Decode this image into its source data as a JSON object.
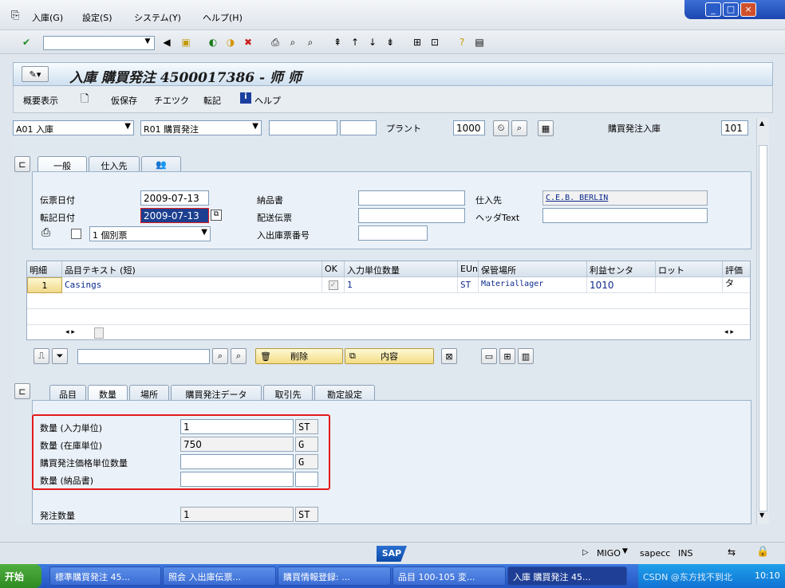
{
  "menu": {
    "items": [
      "入庫(G)",
      "設定(S)",
      "システム(Y)",
      "ヘルプ(H)"
    ]
  },
  "window_controls": {
    "minimize": "_",
    "maximize": "□",
    "close": "×"
  },
  "title": "入庫 購買発注 4500017386 - 师 师",
  "app_toolbar": {
    "overview": "概要表示",
    "hold": "仮保存",
    "check": "チエツク",
    "post": "転記",
    "help": "ヘルプ"
  },
  "header_row": {
    "transaction_select": "A01 入庫",
    "reference_select": "R01 購買発注",
    "field1": "",
    "field2": "",
    "plant_label": "プラント",
    "plant_value": "1000",
    "movement_label": "購買発注入庫",
    "movement_value": "101"
  },
  "header_tabs": [
    "一般",
    "仕入先",
    "👥"
  ],
  "general": {
    "doc_date_label": "伝票日付",
    "doc_date": "2009-07-13",
    "post_date_label": "転記日付",
    "post_date": "2009-07-13",
    "print_select": "1 個別票",
    "delivery_note_label": "納品書",
    "delivery_note": "",
    "bill_of_lading_label": "配送伝票",
    "bill_of_lading": "",
    "slip_number_label": "入出庫票番号",
    "slip_number": "",
    "vendor_label": "仕入先",
    "vendor": "C.E.B. BERLIN",
    "header_text_label": "ヘッダText",
    "header_text": ""
  },
  "grid": {
    "headers": [
      "明細",
      "品目テキスト (短)",
      "OK",
      "入力単位数量",
      "EUn",
      "保管場所",
      "利益センタ",
      "ロット",
      "評価タ"
    ],
    "rows": [
      {
        "line": "1",
        "text": "Casings",
        "qty": "1",
        "unit": "ST",
        "sloc": "Materiallager",
        "profit_center": "1010"
      }
    ]
  },
  "item_toolbar": {
    "delete": "削除",
    "contents": "内容",
    "search_value": ""
  },
  "item_tabs": [
    "品目",
    "数量",
    "場所",
    "購買発注データ",
    "取引先",
    "勘定設定"
  ],
  "quantity": {
    "rows": [
      {
        "label": "数量 (入力単位)",
        "value": "1",
        "unit": "ST"
      },
      {
        "label": "数量 (在庫単位)",
        "value": "750",
        "unit": "G"
      },
      {
        "label": "購買発注価格単位数量",
        "value": "",
        "unit": "G"
      },
      {
        "label": "数量 (納品書)",
        "value": "",
        "unit": ""
      }
    ],
    "order_qty_label": "発注数量",
    "order_qty": "1",
    "order_qty_unit": "ST"
  },
  "status": {
    "tcode": "MIGO",
    "system": "sapecc",
    "mode": "INS"
  },
  "taskbar": {
    "start": "开始",
    "tasks": [
      "標準購買発注 45...",
      "照会 入出庫伝票...",
      "購買情報登録: ...",
      "品目 100-105 変...",
      "入庫 購買発注 45..."
    ],
    "tray_text": "CSDN @东方找不到北",
    "clock": "10:10"
  },
  "colors": {
    "accent": "#2455c3",
    "highlight_box": "#e41a1a",
    "link_text": "#0c2a8c"
  }
}
